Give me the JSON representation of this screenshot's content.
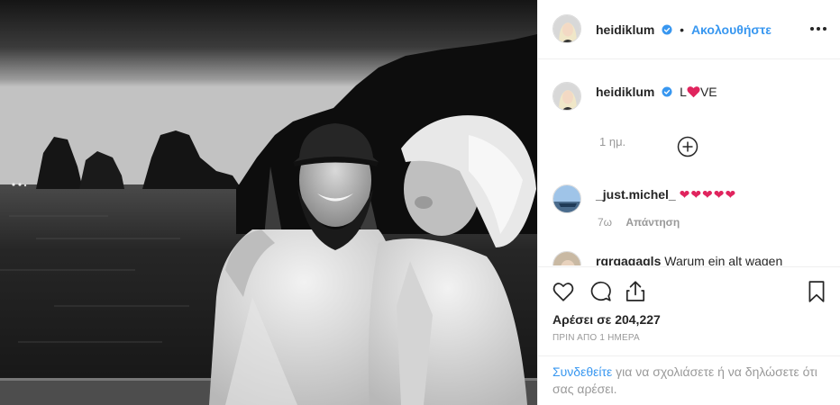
{
  "post": {
    "username": "heidiklum",
    "follow_label": "Ακολουθήστε",
    "separator": "•",
    "verified": true
  },
  "caption": {
    "username": "heidiklum",
    "text_before": "L",
    "text_after": "VE",
    "heart_icon": "red-heart-icon",
    "time": "1 ημ."
  },
  "comments": [
    {
      "username": "_just.michel_",
      "text": "❤❤❤❤❤",
      "time": "7ω",
      "reply_label": "Απάντηση"
    },
    {
      "username": "rgrgagagls",
      "text": "Warum ein alt wagen"
    }
  ],
  "actions": {
    "likes_text": "Αρέσει σε 204,227",
    "date_text": "ΠΡΙΝ ΑΠΟ 1 ΗΜΕΡΑ"
  },
  "login_prompt": {
    "link_text": "Συνδεθείτε",
    "rest_text": " για να σχολιάσετε ή να δηλώσετε ότι σας αρέσει."
  },
  "colors": {
    "link": "#3897f0",
    "verified": "#3897f0",
    "heart": "#e0245e",
    "muted": "#999999"
  }
}
